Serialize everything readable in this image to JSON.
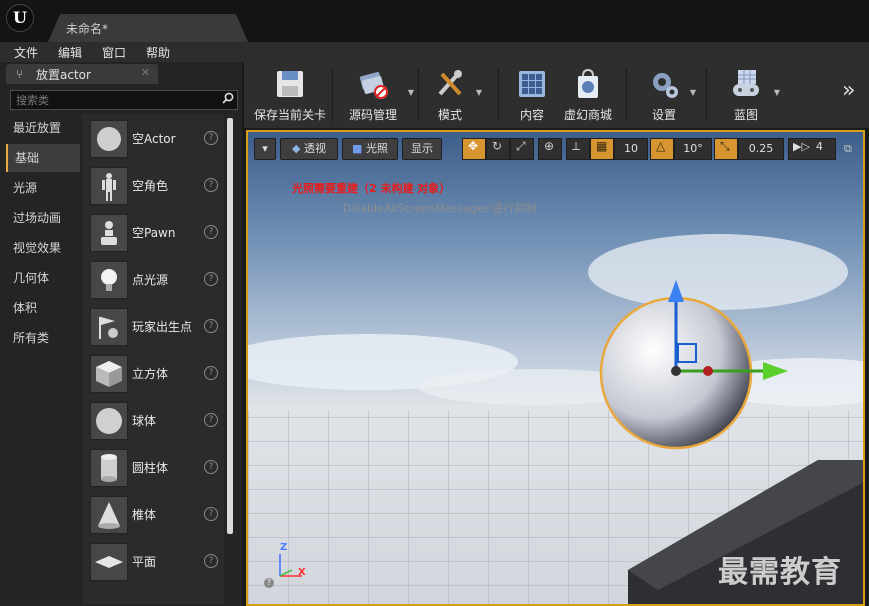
{
  "window": {
    "doc_tab": "未命名*"
  },
  "menu": [
    "文件",
    "编辑",
    "窗口",
    "帮助"
  ],
  "left_panel": {
    "tab_title": "放置actor",
    "search_placeholder": "搜索类",
    "categories": [
      "最近放置",
      "基础",
      "光源",
      "过场动画",
      "视觉效果",
      "几何体",
      "体积",
      "所有类"
    ],
    "active_category": "基础",
    "items": [
      "空Actor",
      "空角色",
      "空Pawn",
      "点光源",
      "玩家出生点",
      "立方体",
      "球体",
      "圆柱体",
      "椎体",
      "平面"
    ]
  },
  "toolbar": {
    "buttons": [
      {
        "label": "保存当前关卡",
        "icon": "save-disk-icon"
      },
      {
        "label": "源码管理",
        "icon": "source-control-icon"
      },
      {
        "label": "模式",
        "icon": "modes-tools-icon"
      },
      {
        "label": "内容",
        "icon": "content-grid-icon"
      },
      {
        "label": "虚幻商城",
        "icon": "marketplace-bag-icon"
      },
      {
        "label": "设置",
        "icon": "settings-gears-icon"
      },
      {
        "label": "蓝图",
        "icon": "blueprint-gamepad-icon"
      }
    ]
  },
  "viewport": {
    "perspective": "透视",
    "lighting": "光照",
    "show": "显示",
    "grid_snap": "10",
    "rotation_snap": "10°",
    "scale_snap": "0.25",
    "camera_speed": "4",
    "warning": "光照需要重建（2 未构建 对象）",
    "suppress_msg": "'DisableAllScreenMessages'进行抑制",
    "axis_z": "Z",
    "axis_x": "X",
    "watermark": "最需教育"
  },
  "colors": {
    "accent": "#d4a017",
    "warning": "#e81d1d",
    "active_tool": "#d69530"
  }
}
